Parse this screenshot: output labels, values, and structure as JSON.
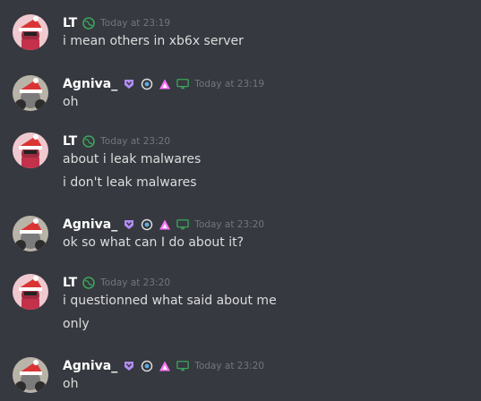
{
  "colors": {
    "background": "#36393f",
    "text": "#dcddde",
    "timestamp": "#72767d",
    "globe_badge": "#3ba55d",
    "nitro_badge": "#b18cf5",
    "pink_triangle": "#ff73fa",
    "monitor_badge": "#3ba55d"
  },
  "messages": [
    {
      "author": "LT",
      "timestamp": "Today at 23:19",
      "lines": [
        "i mean others in xb6x server"
      ]
    },
    {
      "author": "Agniva_",
      "timestamp": "Today at 23:19",
      "lines": [
        "oh"
      ]
    },
    {
      "author": "LT",
      "timestamp": "Today at 23:20",
      "lines": [
        "about i leak malwares",
        "i don't leak malwares"
      ]
    },
    {
      "author": "Agniva_",
      "timestamp": "Today at 23:20",
      "lines": [
        "ok so what can I do about it?"
      ]
    },
    {
      "author": "LT",
      "timestamp": "Today at 23:20",
      "lines": [
        "i questionned what said about me",
        "only"
      ]
    },
    {
      "author": "Agniva_",
      "timestamp": "Today at 23:20",
      "lines": [
        "oh"
      ]
    }
  ],
  "icons": {
    "lt_avatar": "santa-hat-avatar-icon",
    "agniva_avatar": "santa-hat-avatar-icon",
    "globe": "globe-icon",
    "nitro": "nitro-badge-icon",
    "halo": "halo-icon",
    "triangle": "triangle-icon",
    "monitor": "monitor-icon"
  }
}
